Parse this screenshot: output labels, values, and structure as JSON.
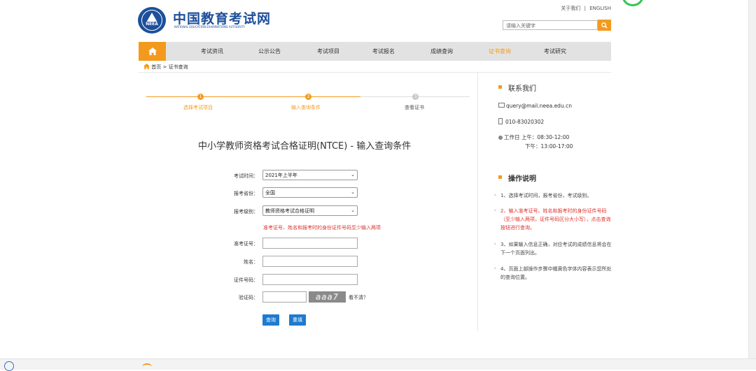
{
  "header": {
    "site_title": "中国教育考试网",
    "site_subtitle": "NATIONAL EDUCATION EXAMINATIONS AUTHORITY",
    "logo_text": "NEEA",
    "top_links": {
      "about": "关于我们",
      "separator": "|",
      "english": "ENGLISH"
    },
    "search_placeholder": "请输入关键字"
  },
  "nav": {
    "items": [
      "考试资讯",
      "公示公告",
      "考试项目",
      "考试报名",
      "成绩查询",
      "证书查询",
      "考试研究"
    ],
    "active_index": 5
  },
  "breadcrumb": {
    "home": "首页",
    "separator": ">",
    "current": "证书查询"
  },
  "steps": [
    {
      "num": "1",
      "label": "选择考试项目",
      "state": "done"
    },
    {
      "num": "2",
      "label": "输入查询条件",
      "state": "current"
    },
    {
      "num": "3",
      "label": "查看证书",
      "state": "todo"
    }
  ],
  "page_heading": "中小学教师资格考试合格证明(NTCE) - 输入查询条件",
  "form": {
    "exam_time": {
      "label": "考试时间：",
      "value": "2021年上半年"
    },
    "province": {
      "label": "报考省份：",
      "value": "全国"
    },
    "level": {
      "label": "报考级别：",
      "value": "教师资格考试合格证明"
    },
    "hint": "准考证号、姓名和报考时的身份证件号码至少输入两项",
    "ticket_no": {
      "label": "准考证号：",
      "value": ""
    },
    "name": {
      "label": "姓名：",
      "value": ""
    },
    "id_no": {
      "label": "证件号码：",
      "value": ""
    },
    "captcha": {
      "label": "验证码：",
      "value": "",
      "image_text": "aaa7",
      "refresh": "看不清？"
    },
    "submit_label": "查询",
    "reset_label": "重填"
  },
  "contact": {
    "title": "联系我们",
    "email": "query@mail.neea.edu.cn",
    "phone": "010-83020302",
    "hours_line1": "工作日 上午：08:30-12:00",
    "hours_line2": "下午：13:00-17:00"
  },
  "instructions": {
    "title": "操作说明",
    "items": [
      "1、选择考试时间，报考省份，考试级别。",
      "2、输入准考证号、姓名和报考时的身份证件号码（至少输入两项，证件号码区分大小写），点击查询按钮进行查询。",
      "3、如果输入信息正确，对应考试的成绩信息将会在下一个页面列出。",
      "4、页面上部操作步骤中橘黄色字体内容表示您所处的查询位置。"
    ]
  },
  "colors": {
    "brand_blue": "#1d4f9a",
    "accent_orange": "#f39a1e",
    "hint_red": "#e0302b",
    "button_blue": "#1e7bd0"
  }
}
